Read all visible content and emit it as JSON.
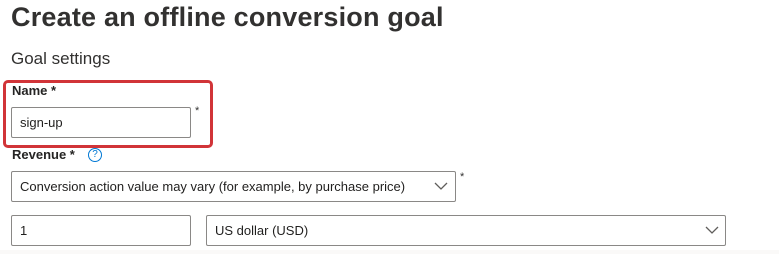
{
  "page": {
    "title": "Create an offline conversion goal",
    "section_title": "Goal settings"
  },
  "form": {
    "name": {
      "label": "Name *",
      "value": "sign-up",
      "required_marker": "*"
    },
    "revenue": {
      "label": "Revenue *",
      "help_icon": "question-circle-icon",
      "help_glyph": "?",
      "selected": "Conversion action value may vary (for example, by purchase price)",
      "required_marker": "*",
      "dropdown_icon": "chevron-down-icon"
    },
    "value": {
      "value": "1"
    },
    "currency": {
      "selected": "US dollar (USD)",
      "dropdown_icon": "chevron-down-icon"
    }
  },
  "colors": {
    "highlight": "#d13438",
    "accent": "#0078d4",
    "input_border": "#8a8886",
    "text": "#252423"
  }
}
